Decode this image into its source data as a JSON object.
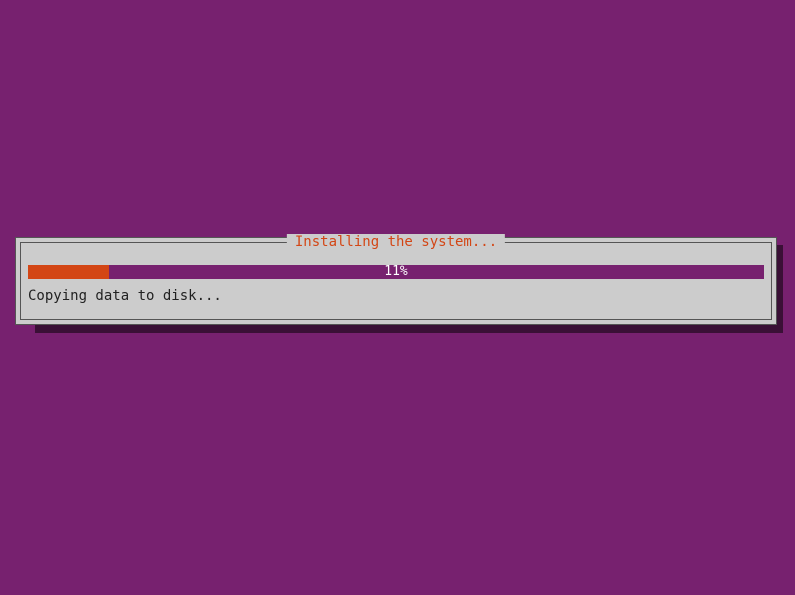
{
  "dialog": {
    "title": "Installing the system...",
    "progress_percent": 11,
    "progress_label": "11%",
    "status_text": "Copying data to disk..."
  },
  "colors": {
    "background": "#77216f",
    "dialog_bg": "#cccccc",
    "accent": "#d34615",
    "progress_track": "#77216f",
    "shadow": "#3a1036"
  }
}
